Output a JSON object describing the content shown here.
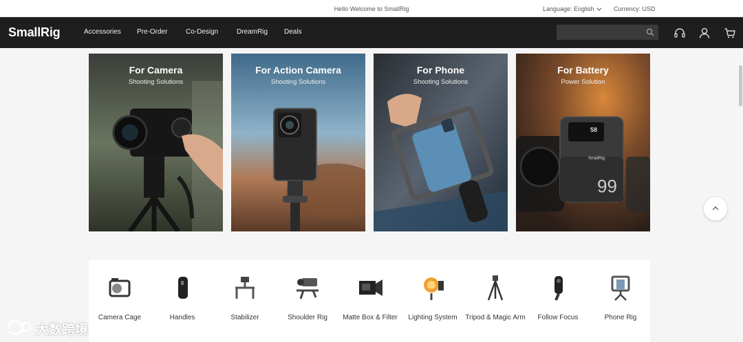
{
  "topbar": {
    "welcome": "Hello Welcome to SmallRig",
    "language": "Language: English",
    "currency": "Currency: USD"
  },
  "navbar": {
    "logo": "SmallRig",
    "items": [
      "Accessories",
      "Pre-Order",
      "Co-Design",
      "DreamRig",
      "Deals"
    ],
    "search_placeholder": ""
  },
  "hero": [
    {
      "title": "For Camera",
      "subtitle": "Shooting Solutions"
    },
    {
      "title": "For Action Camera",
      "subtitle": "Shooting Solutions"
    },
    {
      "title": "For Phone",
      "subtitle": "Shooting Solutions"
    },
    {
      "title": "For Battery",
      "subtitle": "Power Solution"
    }
  ],
  "battery_display": {
    "percent": "58",
    "brand": "SmallRig",
    "model": "99"
  },
  "categories": [
    {
      "label": "Camera Cage"
    },
    {
      "label": "Handles"
    },
    {
      "label": "Stabilizer"
    },
    {
      "label": "Shoulder Rig"
    },
    {
      "label": "Matte Box & Filter"
    },
    {
      "label": "Lighting System"
    },
    {
      "label": "Tripod & Magic Arm"
    },
    {
      "label": "Follow Focus"
    },
    {
      "label": "Phone Rig"
    }
  ],
  "watermark": {
    "text": "大数跨境"
  },
  "colors": {
    "nav_bg": "#1e1e1e",
    "page_bg": "#f5f5f5",
    "panel_bg": "#ffffff"
  }
}
